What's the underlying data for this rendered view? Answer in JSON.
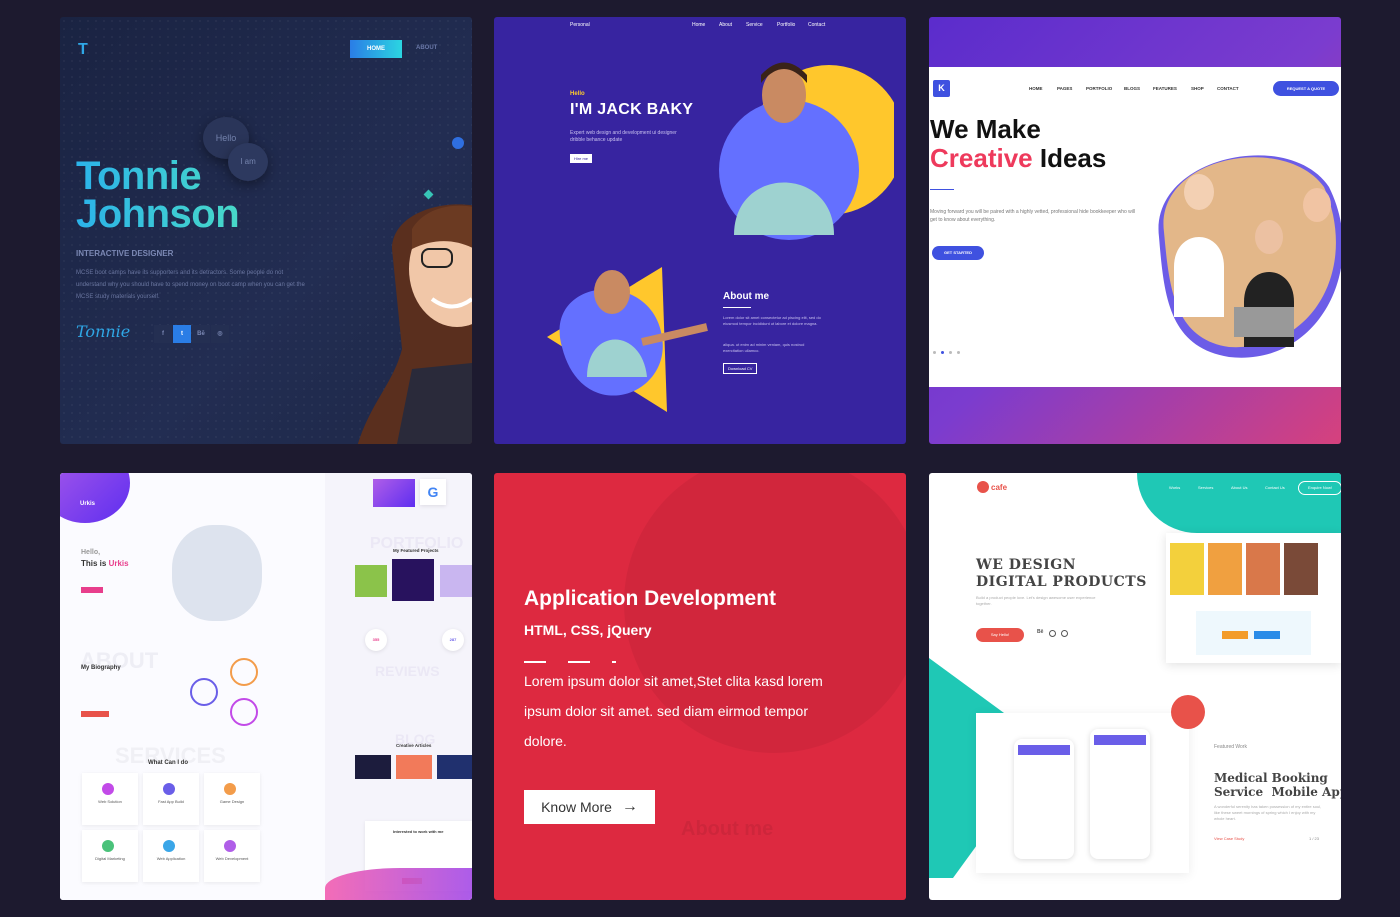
{
  "card1": {
    "logo": "T",
    "nav_home": "HOME",
    "nav_about": "ABOUT",
    "bubble_hello": "Hello",
    "bubble_iam": "I am",
    "name_line1": "Tonnie",
    "name_line2": "Johnson",
    "role": "INTERACTIVE DESIGNER",
    "description": "MCSE boot camps have its supporters and its detractors. Some people do not understand why you should have to spend money on boot camp when you can get the MCSE study materials yourself.",
    "signature": "Tonnie",
    "socials": [
      "f",
      "t",
      "Bē",
      "◎"
    ]
  },
  "card2": {
    "brand": "Personal",
    "nav": [
      "Home",
      "About",
      "Service",
      "Portfolio",
      "Contact"
    ],
    "hello": "Hello",
    "title": "I'M JACK BAKY",
    "subtitle": "Expert web design and development ui designer dribble behance update",
    "hire_button": "Hire me",
    "about_title": "About me",
    "about_text1": "Lorem dolor sit amet consectetur ad piscing elit, sed do eiusmod tempor incididunt ut labore et dolore magna.",
    "about_text2": "aliqua. ut enim ad minim veniam, quis nostrud exercitation ullamco.",
    "download_button": "Download CV"
  },
  "card3": {
    "logo": "K",
    "nav": [
      "HOME",
      "PAGES",
      "PORTFOLIO",
      "BLOGS",
      "FEATURES",
      "SHOP",
      "CONTACT"
    ],
    "quote_button": "REQUEST A QUOTE",
    "headline_line1": "We Make",
    "headline_accent": "Creative",
    "headline_rest": " Ideas",
    "paragraph": "Moving forward you will be paired with a highly vetted, professional hide bookkeeper who will get to know about everything.",
    "cta": "GET STARTED",
    "accent_color": "#ee3a5c",
    "brand_color": "#3f51e0"
  },
  "card4": {
    "logo": "Urkis",
    "greeting": "Hello,",
    "intro_prefix": "This is ",
    "intro_name": "Urkis",
    "portfolio_bg": "PORTFOLIO",
    "featured": "My Featured Projects",
    "about_bg": "ABOUT",
    "bio_title": "My Biography",
    "reviews_bg": "REVIEWS",
    "services_bg": "SERVICES",
    "what_title": "What Can I do",
    "blog_bg": "BLOG",
    "articles_title": "Creative Articles",
    "contact_title": "Interested to work with me",
    "stat1": "355",
    "stat2": "287",
    "services": [
      "Web Solution",
      "Fast App Build",
      "Game Design",
      "Digital Marketing",
      "Web Application",
      "Web Development"
    ]
  },
  "card5": {
    "title": "Application Development",
    "subtitle": "HTML, CSS, jQuery",
    "body": "Lorem ipsum dolor sit amet,Stet clita kasd lorem ipsum dolor sit amet. sed diam eirmod tempor dolore.",
    "button": "Know More",
    "ghost_text": "About me",
    "bg_color": "#dd2940"
  },
  "card6": {
    "logo": "cafe",
    "nav": [
      "Works",
      "Services",
      "About Us",
      "Contact Us"
    ],
    "nav_button": "Enquire Now!",
    "headline": "WE DESIGN\nDIGITAL PRODUCTS",
    "paragraph": "Build a product people love. Let's design awesome user experience together.",
    "cta": "Say Hello!",
    "featured": "Featured Work",
    "mobile_title": "Medical Booking\nService  Mobile App",
    "mobile_text": "A wonderful serenity has taken possession of my entire soul, like these sweet mornings of spring which I enjoy with my whole heart.",
    "view_case": "View Case Study",
    "pager": "1 / 23"
  }
}
